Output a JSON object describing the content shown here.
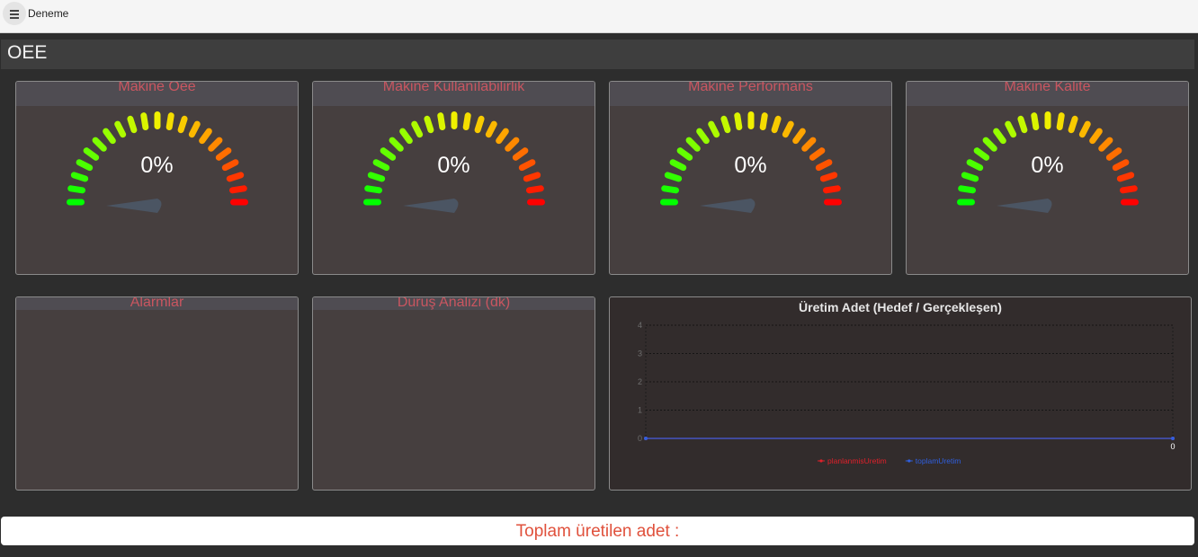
{
  "app": {
    "title": "Deneme",
    "menu_icon": "hamburger-icon"
  },
  "section": {
    "title": "OEE"
  },
  "gauges": [
    {
      "title": "Makine Oee",
      "value": "0%"
    },
    {
      "title": "Makine Kullanılabilirlik",
      "value": "0%"
    },
    {
      "title": "Makine Performans",
      "value": "0%"
    },
    {
      "title": "Makine Kalite",
      "value": "0%"
    }
  ],
  "panels": {
    "alarms": {
      "title": "Alarmlar"
    },
    "downtime": {
      "title": "Duruş Analizi (dk)"
    }
  },
  "chart_data": {
    "type": "line",
    "title": "Üretim Adet (Hedef / Gerçekleşen)",
    "x_labels": [
      "0"
    ],
    "yticks": [
      "0",
      "1",
      "2",
      "3",
      "4"
    ],
    "ylim": [
      0,
      4
    ],
    "grid": true,
    "legend_position": "bottom",
    "series": [
      {
        "name": "planlanmisUretim",
        "color": "#e0202a",
        "values": [
          0,
          0
        ]
      },
      {
        "name": "toplamUretim",
        "color": "#2f5fe0",
        "values": [
          0,
          0
        ]
      }
    ]
  },
  "footer": {
    "label": "Toplam üretilen adet :"
  }
}
